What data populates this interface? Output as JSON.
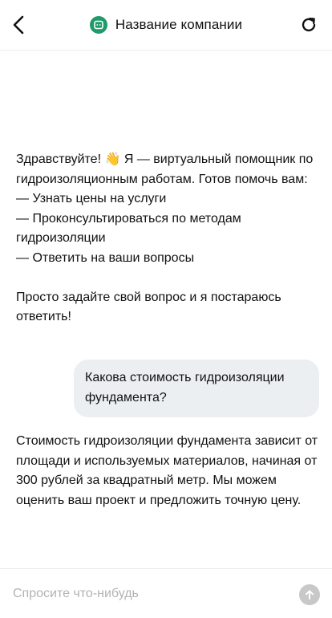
{
  "header": {
    "company_name": "Название компании",
    "back_icon": "chevron-left-icon",
    "refresh_icon": "refresh-icon",
    "logo_icon": "chat-bot-logo-icon",
    "accent_color": "#1f9a6a"
  },
  "messages": [
    {
      "role": "bot",
      "text": "Здравствуйте! 👋 Я — виртуальный помощник по гидроизоляционным работам. Готов помочь вам:\n— Узнать цены на услуги\n— Проконсультироваться по методам гидроизоляции\n— Ответить на ваши вопросы\n\nПросто задайте свой вопрос и я постараюсь ответить!"
    },
    {
      "role": "user",
      "text": "Какова стоимость гидроизоляции фундамента?"
    },
    {
      "role": "bot",
      "text": "Стоимость гидроизоляции фундамента зависит от площади и используемых материалов, начиная от 300 рублей за квадратный метр. Мы можем оценить ваш проект и предложить точную цену."
    }
  ],
  "composer": {
    "placeholder": "Спросите что-нибудь",
    "value": "",
    "send_icon": "arrow-up-icon"
  }
}
